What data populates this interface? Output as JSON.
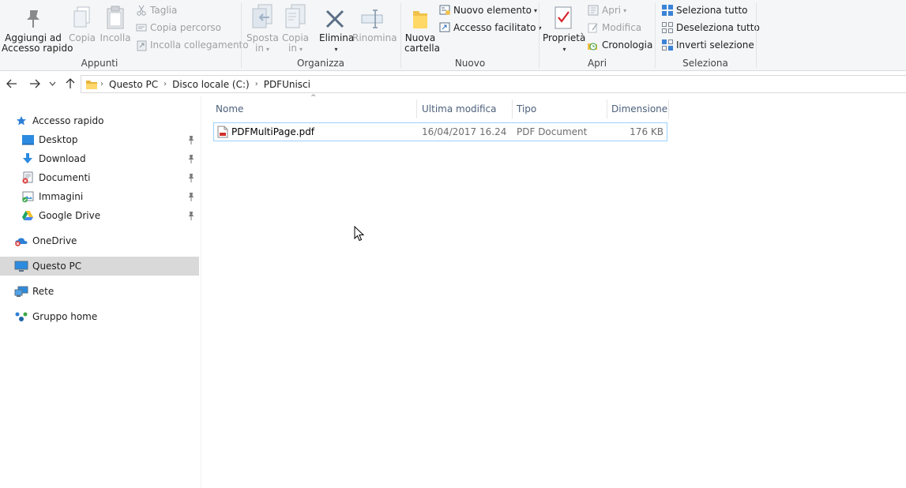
{
  "ribbon": {
    "appunti": {
      "label": "Appunti",
      "pin_line1": "Aggiungi ad",
      "pin_line2": "Accesso rapido",
      "copy": "Copia",
      "paste": "Incolla",
      "cut": "Taglia",
      "copy_path": "Copia percorso",
      "paste_shortcut": "Incolla collegamento"
    },
    "organizza": {
      "label": "Organizza",
      "move_line1": "Sposta",
      "move_line2": "in",
      "copyto_line1": "Copia",
      "copyto_line2": "in",
      "delete": "Elimina",
      "rename": "Rinomina"
    },
    "nuovo": {
      "label": "Nuovo",
      "new_folder_line1": "Nuova",
      "new_folder_line2": "cartella",
      "new_item": "Nuovo elemento",
      "easy_access": "Accesso facilitato"
    },
    "apri": {
      "label": "Apri",
      "properties": "Proprietà",
      "open": "Apri",
      "edit": "Modifica",
      "history": "Cronologia"
    },
    "seleziona": {
      "label": "Seleziona",
      "select_all": "Seleziona tutto",
      "select_none": "Deseleziona tutto",
      "invert": "Inverti selezione"
    }
  },
  "address": {
    "crumbs": [
      "Questo PC",
      "Disco locale (C:)",
      "PDFUnisci"
    ]
  },
  "nav": {
    "quick_access": "Accesso rapido",
    "desktop": "Desktop",
    "download": "Download",
    "documents": "Documenti",
    "images": "Immagini",
    "gdrive": "Google Drive",
    "onedrive": "OneDrive",
    "this_pc": "Questo PC",
    "network": "Rete",
    "homegroup": "Gruppo home"
  },
  "columns": {
    "name": "Nome",
    "modified": "Ultima modifica",
    "type": "Tipo",
    "size": "Dimensione"
  },
  "files": [
    {
      "name": "PDFMultiPage.pdf",
      "modified": "16/04/2017 16.24",
      "type": "PDF Document",
      "size": "176 KB"
    }
  ],
  "colors": {
    "ribbon_bg": "#f5f6f7",
    "selection_border": "#99d1ff",
    "nav_selected": "#d9d9d9",
    "header_text": "#4c607a",
    "accent_blue": "#1e78d6"
  }
}
